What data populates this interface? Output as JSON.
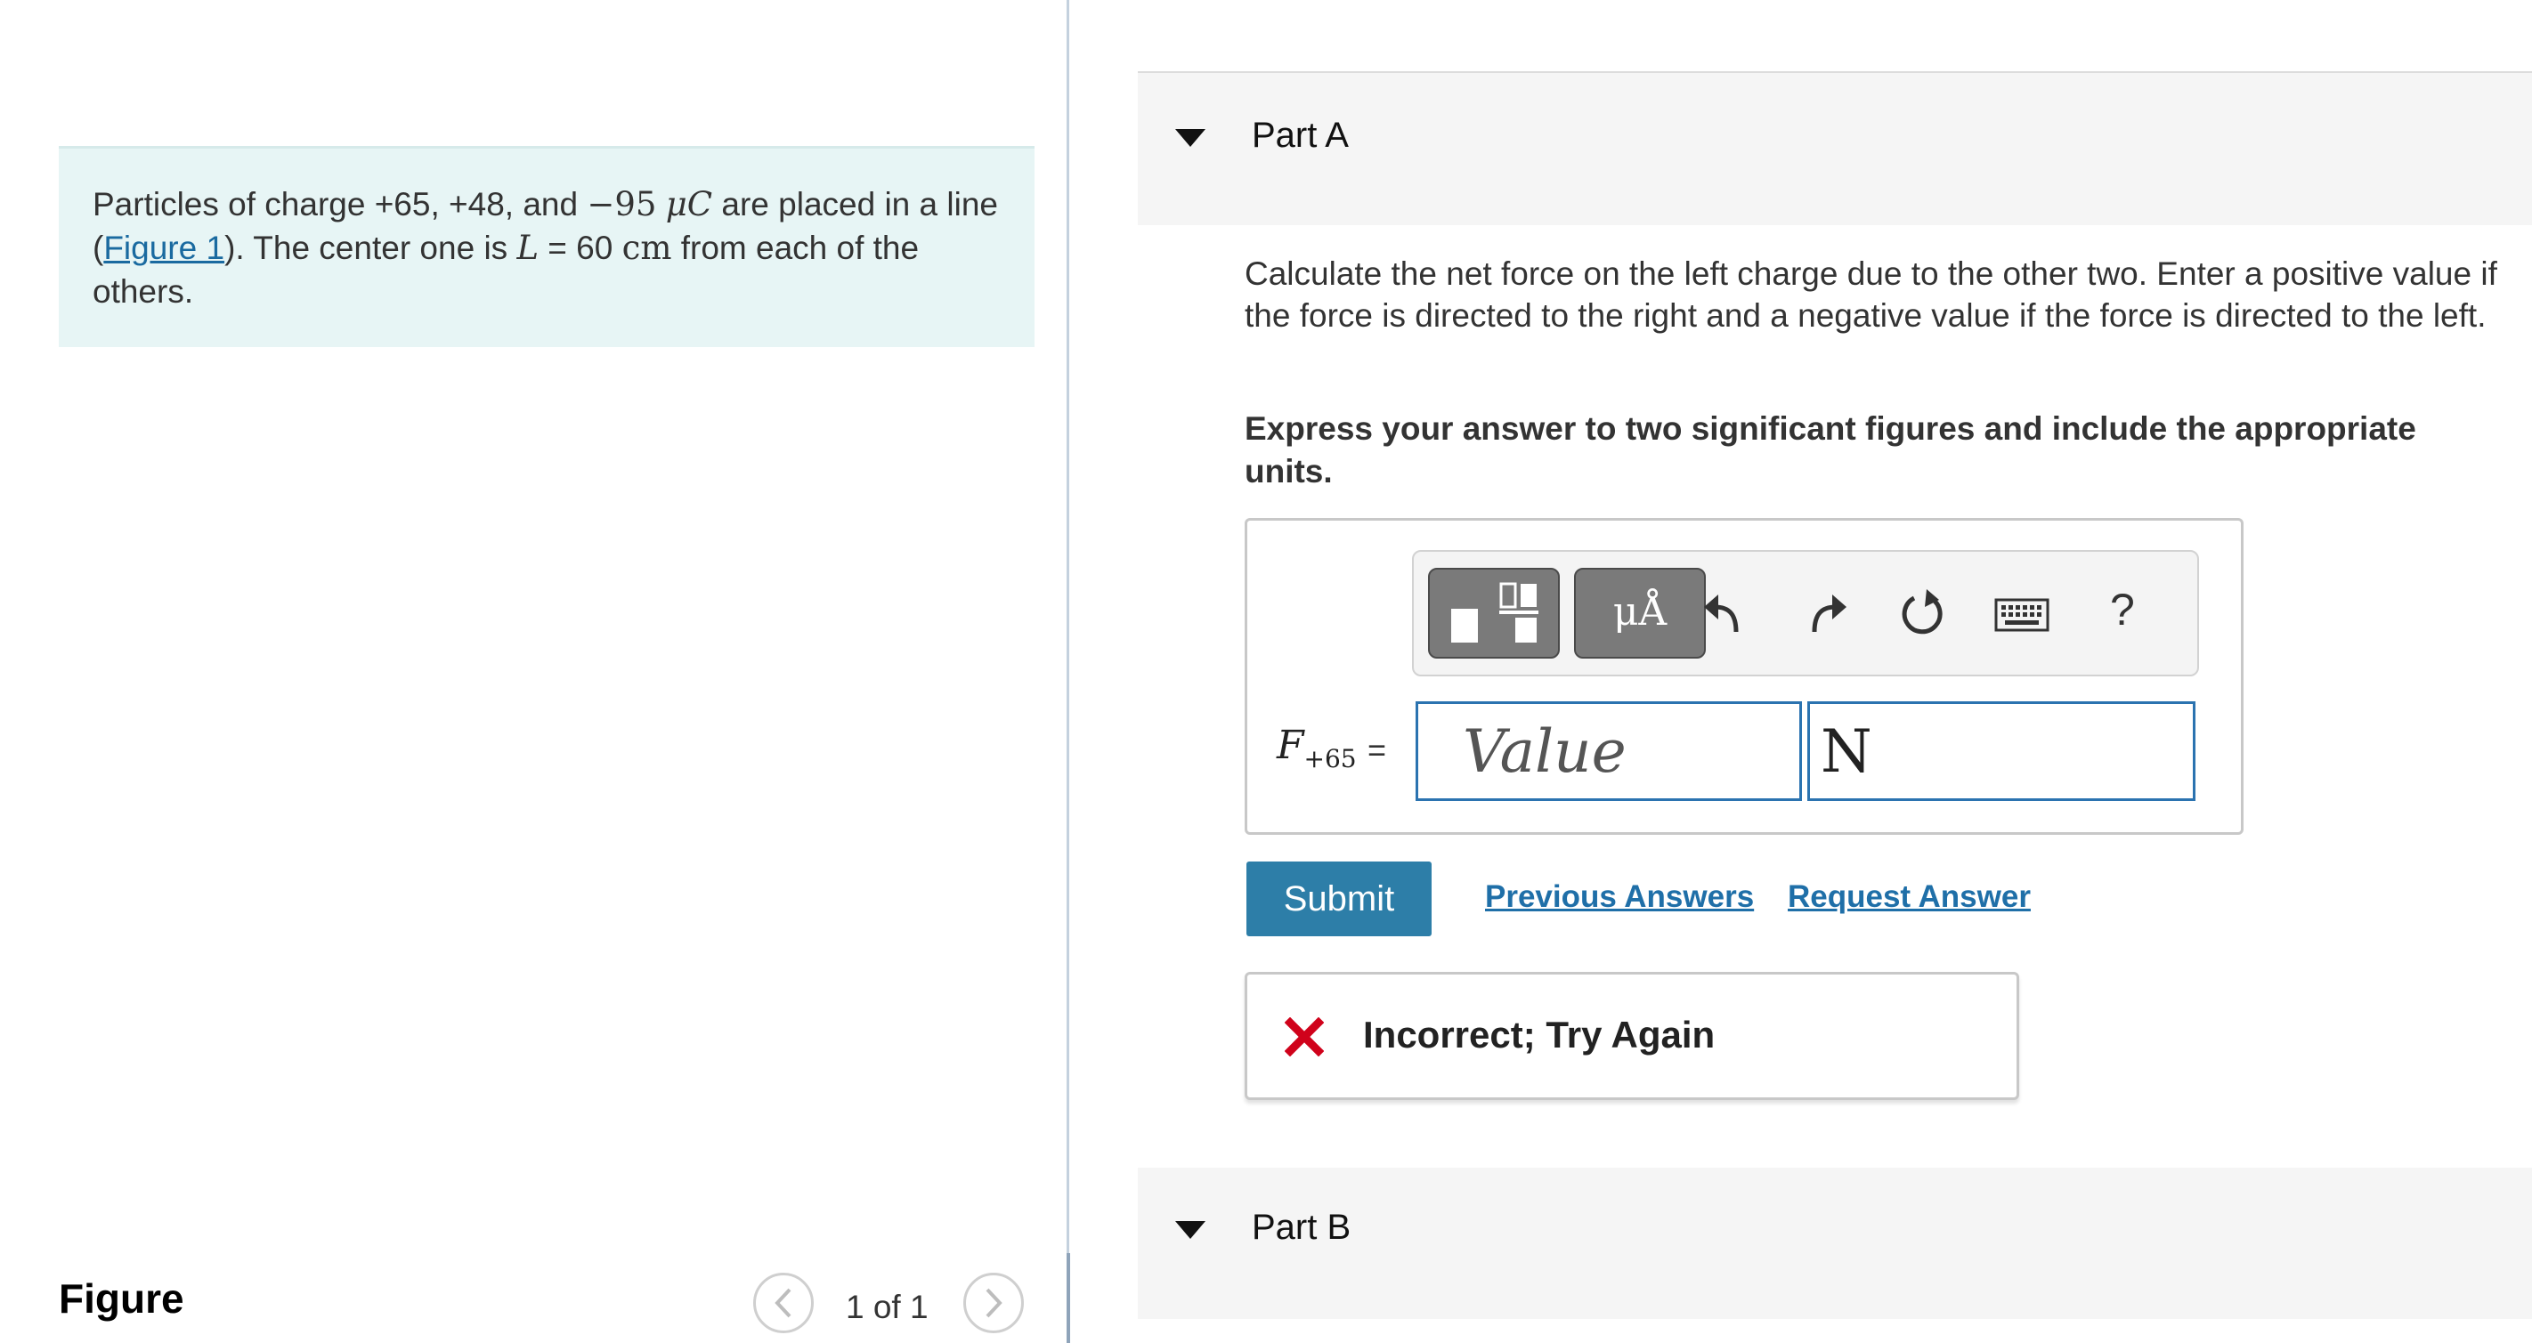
{
  "problem": {
    "text_part1": "Particles of charge +65, +48, and ",
    "text_neg": "−95",
    "text_unit_mu": "μC",
    "text_part2": " are placed in a line (",
    "figure_link": "Figure 1",
    "text_part3": "). The center one is ",
    "var_L": "L",
    "text_eq": " = 60 ",
    "unit_cm": " cm",
    "text_part4": " from each of the others."
  },
  "figure": {
    "heading": "Figure",
    "counter": "1 of 1"
  },
  "partA": {
    "title": "Part A",
    "question": "Calculate the net force on the left charge due to the other two. Enter a positive value if the force is directed to the right and a negative value if the force is directed to the left.",
    "instruction": "Express your answer to two significant figures and include the appropriate units.",
    "toolbar": {
      "units_label": "μÅ",
      "help_label": "?"
    },
    "variable": "F",
    "variable_sub": "+65",
    "equals": "=",
    "value_placeholder": "Value",
    "unit_value": "N",
    "submit_label": "Submit",
    "previous_answers_label": "Previous Answers",
    "request_answer_label": "Request Answer",
    "feedback": "Incorrect; Try Again",
    "feedback_color": "#d0021b"
  },
  "partB": {
    "title": "Part B"
  }
}
